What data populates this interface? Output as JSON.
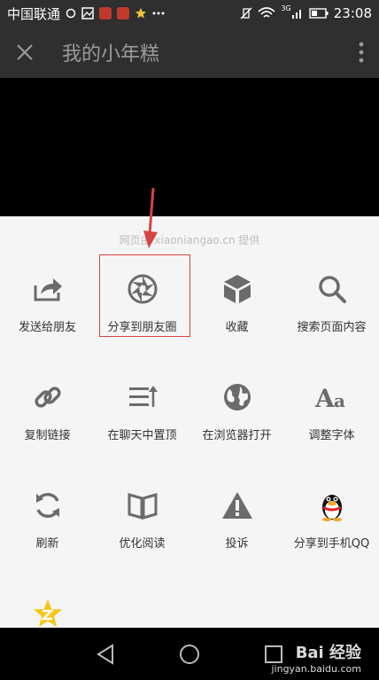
{
  "status_bar": {
    "carrier": "中国联通",
    "network": "3G",
    "time": "23:08"
  },
  "title_bar": {
    "title": "我的小年糕"
  },
  "sheet": {
    "provider": "网页由 xiaoniangao.cn 提供",
    "items": [
      {
        "label": "发送给朋友",
        "icon": "share-forward-icon"
      },
      {
        "label": "分享到朋友圈",
        "icon": "moments-aperture-icon"
      },
      {
        "label": "收藏",
        "icon": "favorite-cube-icon"
      },
      {
        "label": "搜索页面内容",
        "icon": "search-icon"
      },
      {
        "label": "复制链接",
        "icon": "link-icon"
      },
      {
        "label": "在聊天中置顶",
        "icon": "pin-top-icon"
      },
      {
        "label": "在浏览器打开",
        "icon": "globe-icon"
      },
      {
        "label": "调整字体",
        "icon": "font-size-icon"
      },
      {
        "label": "刷新",
        "icon": "refresh-icon"
      },
      {
        "label": "优化阅读",
        "icon": "book-icon"
      },
      {
        "label": "投诉",
        "icon": "warning-icon"
      },
      {
        "label": "分享到手机QQ",
        "icon": "qq-penguin-icon"
      },
      {
        "label": "",
        "icon": "qzone-star-icon"
      }
    ]
  },
  "watermark": {
    "brand": "Bai 经验",
    "site": "jingyan.baidu.com"
  },
  "colors": {
    "bar_bg": "#2f2f2f",
    "sheet_bg": "#f5f5f5",
    "icon_gray": "#6b6b6b",
    "highlight_red": "#d64541",
    "qzone_yellow": "#f5c518"
  }
}
